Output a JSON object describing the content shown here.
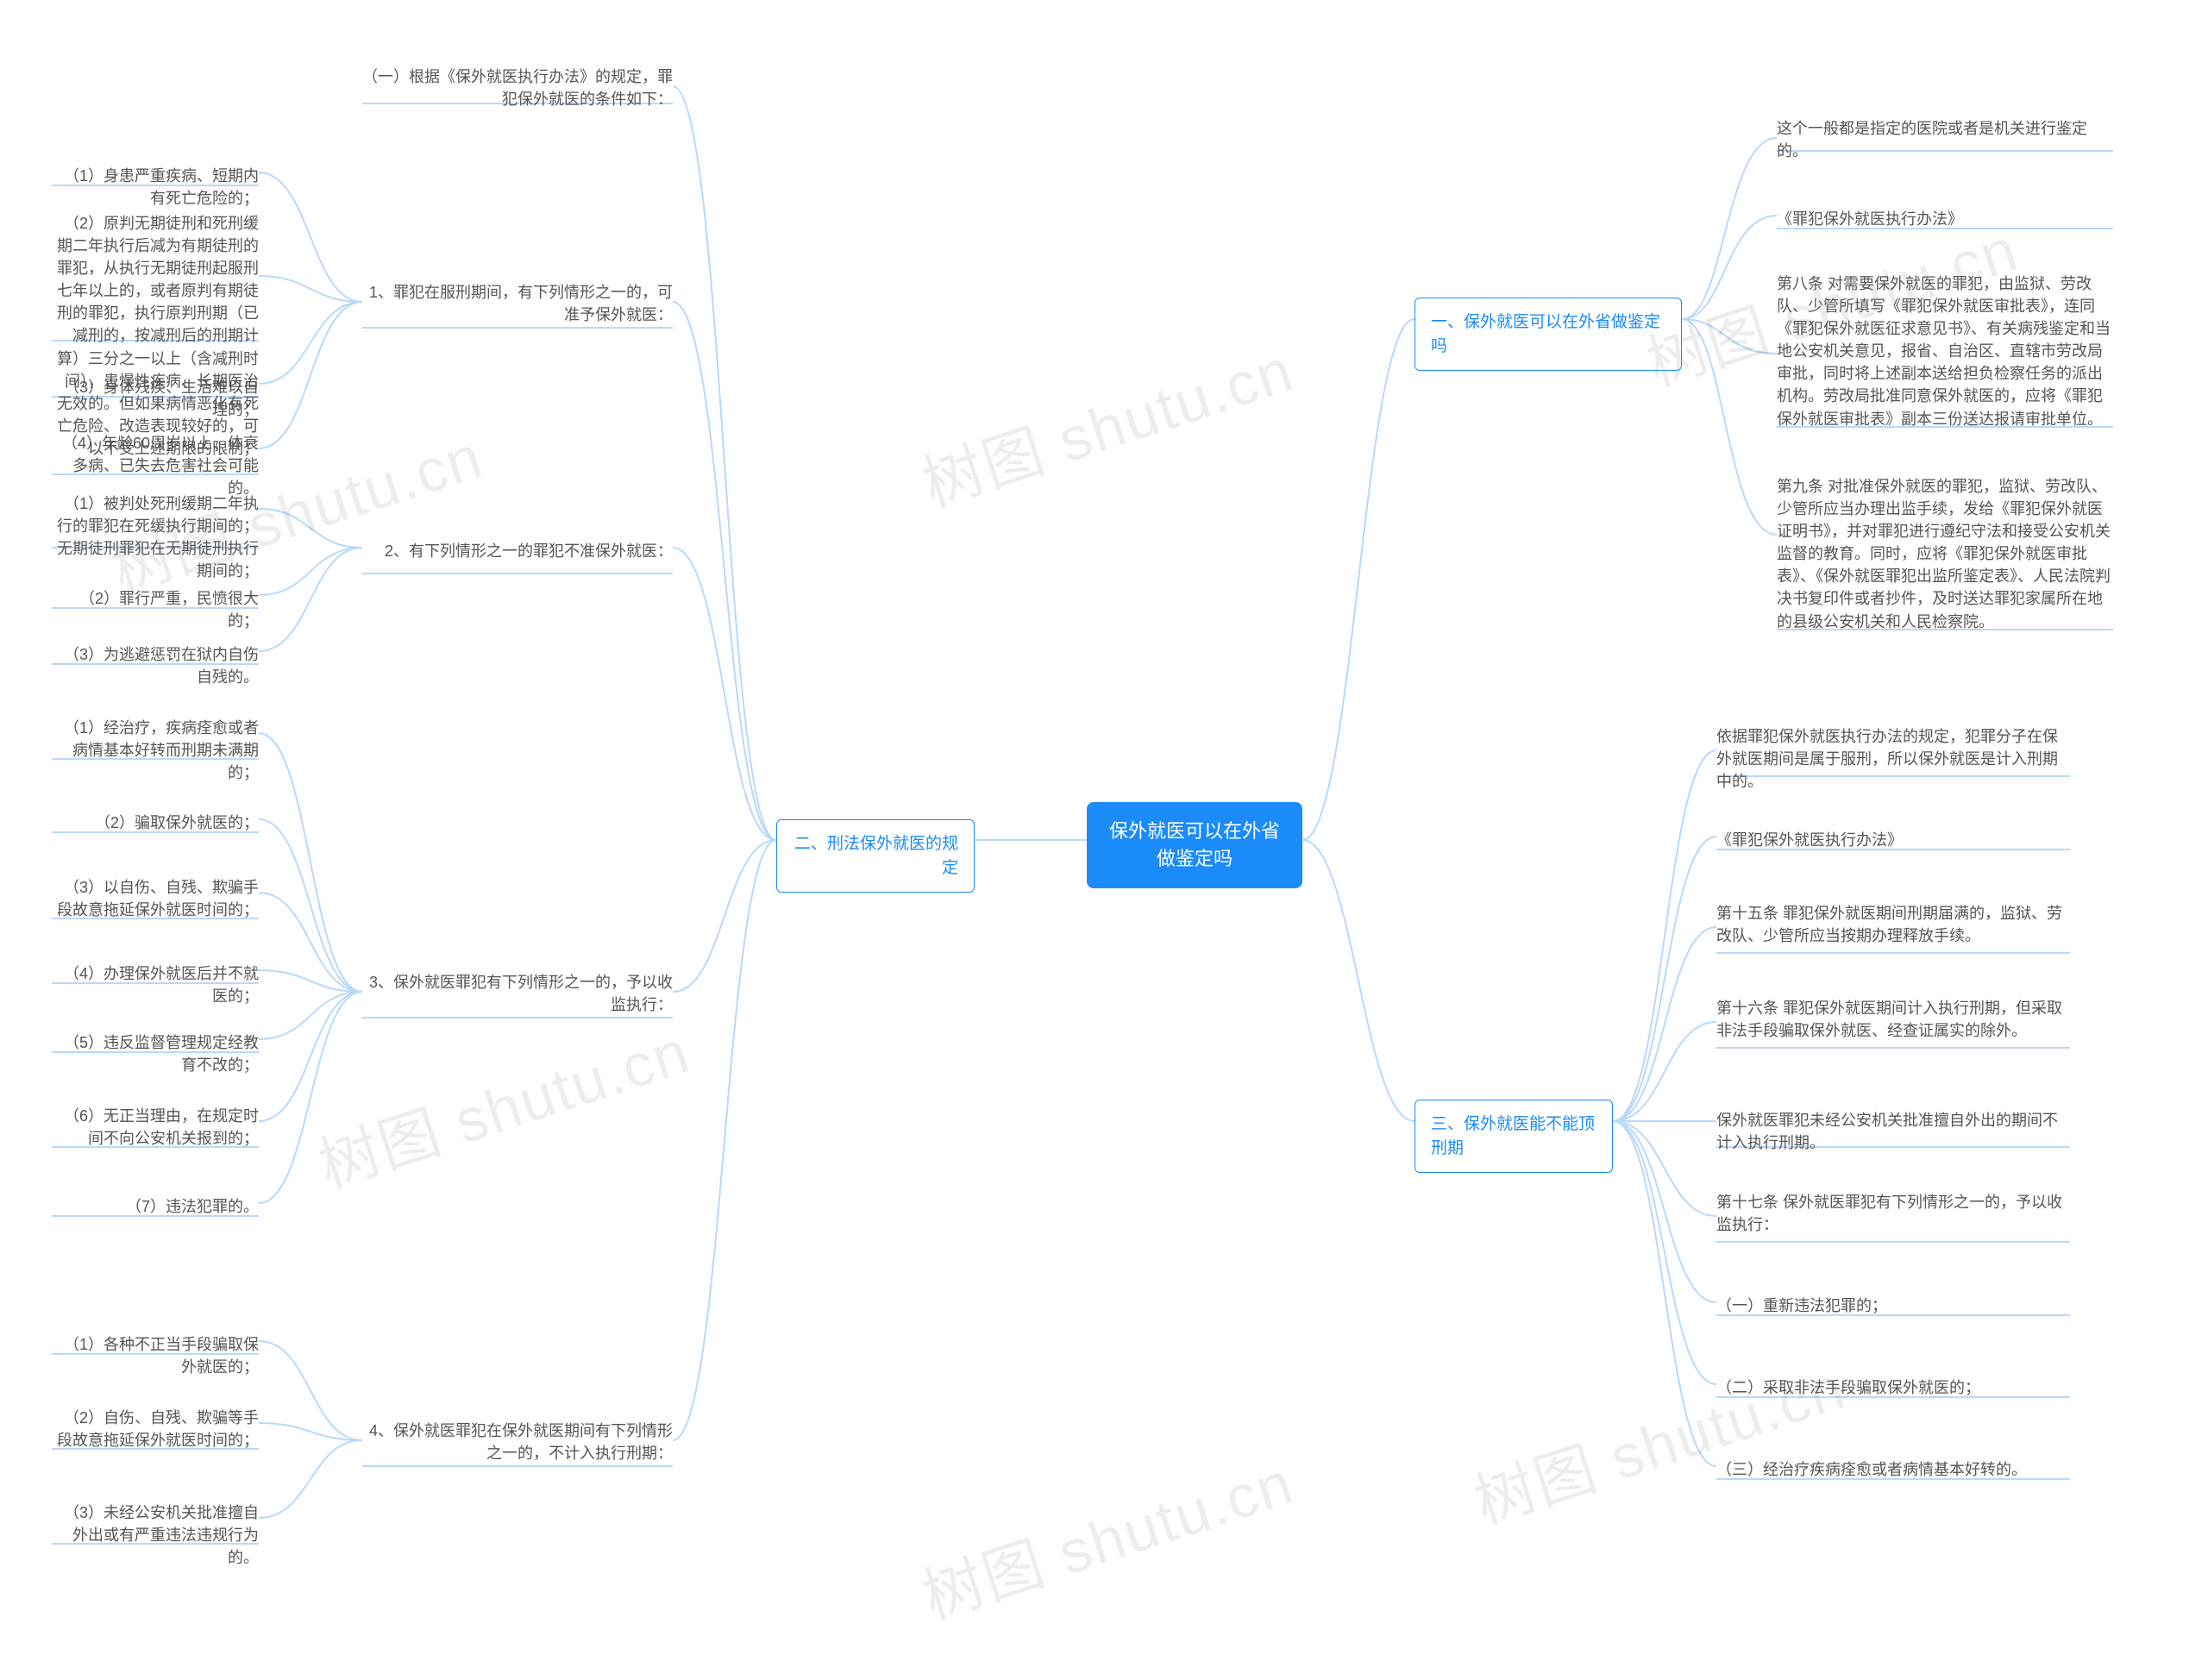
{
  "root": "保外就医可以在外省做鉴定吗",
  "branches": {
    "s1": {
      "title": "一、保外就医可以在外省做鉴定吗",
      "children": [
        "这个一般都是指定的医院或者是机关进行鉴定的。",
        "《罪犯保外就医执行办法》",
        "第八条 对需要保外就医的罪犯，由监狱、劳改队、少管所填写《罪犯保外就医审批表》，连同《罪犯保外就医征求意见书》、有关病残鉴定和当地公安机关意见，报省、自治区、直辖市劳改局审批，同时将上述副本送给担负检察任务的派出机构。劳改局批准同意保外就医的，应将《罪犯保外就医审批表》副本三份送达报请审批单位。",
        "第九条 对批准保外就医的罪犯，监狱、劳改队、少管所应当办理出监手续，发给《罪犯保外就医证明书》，并对罪犯进行遵纪守法和接受公安机关监督的教育。同时，应将《罪犯保外就医审批表》、《保外就医罪犯出监所鉴定表》、人民法院判决书复印件或者抄件，及时送达罪犯家属所在地的县级公安机关和人民检察院。"
      ]
    },
    "s3": {
      "title": "三、保外就医能不能顶刑期",
      "children": [
        "依据罪犯保外就医执行办法的规定，犯罪分子在保外就医期间是属于服刑，所以保外就医是计入刑期中的。",
        "《罪犯保外就医执行办法》",
        "第十五条 罪犯保外就医期间刑期届满的，监狱、劳改队、少管所应当按期办理释放手续。",
        "第十六条 罪犯保外就医期间计入执行刑期，但采取非法手段骗取保外就医、经查证属实的除外。",
        "保外就医罪犯未经公安机关批准擅自外出的期间不计入执行刑期。",
        "第十七条 保外就医罪犯有下列情形之一的，予以收监执行：",
        "（一）重新违法犯罪的；",
        "（二）采取非法手段骗取保外就医的；",
        "（三）经治疗疾病痊愈或者病情基本好转的。"
      ]
    },
    "s2": {
      "title": "二、刑法保外就医的规定",
      "children": [
        {
          "label": "（一）根据《保外就医执行办法》的规定，罪犯保外就医的条件如下：",
          "children": []
        },
        {
          "label": "1、罪犯在服刑期间，有下列情形之一的，可准予保外就医：",
          "children": [
            "（1）身患严重疾病、短期内有死亡危险的；",
            "（2）原判无期徒刑和死刑缓期二年执行后减为有期徒刑的罪犯，从执行无期徒刑起服刑七年以上的，或者原判有期徒刑的罪犯，执行原判刑期（已减刑的，按减刑后的刑期计算）三分之一以上（含减刑时间），患慢性疾病、长期医治无效的。但如果病情恶化有死亡危险、改造表现较好的，可以不受上述期限的限制；",
            "（3）身体残疾、生活难以自理的；",
            "（4）年龄60周岁以上、体衰多病、已失去危害社会可能的。"
          ]
        },
        {
          "label": "2、有下列情形之一的罪犯不准保外就医：",
          "children": [
            "（1）被判处死刑缓期二年执行的罪犯在死缓执行期间的；无期徒刑罪犯在无期徒刑执行期间的；",
            "（2）罪行严重，民愤很大的；",
            "（3）为逃避惩罚在狱内自伤自残的。"
          ]
        },
        {
          "label": "3、保外就医罪犯有下列情形之一的，予以收监执行：",
          "children": [
            "（1）经治疗，疾病痊愈或者病情基本好转而刑期未满期的；",
            "（2）骗取保外就医的；",
            "（3）以自伤、自残、欺骗手段故意拖延保外就医时间的；",
            "（4）办理保外就医后并不就医的；",
            "（5）违反监督管理规定经教育不改的；",
            "（6）无正当理由，在规定时间不向公安机关报到的；",
            "（7）违法犯罪的。"
          ]
        },
        {
          "label": "4、保外就医罪犯在保外就医期间有下列情形之一的，不计入执行刑期：",
          "children": [
            "（1）各种不正当手段骗取保外就医的；",
            "（2）自伤、自残、欺骗等手段故意拖延保外就医时间的；",
            "（3）未经公安机关批准擅自外出或有严重违法违规行为的。"
          ]
        }
      ]
    }
  },
  "watermark": "树图 shutu.cn"
}
